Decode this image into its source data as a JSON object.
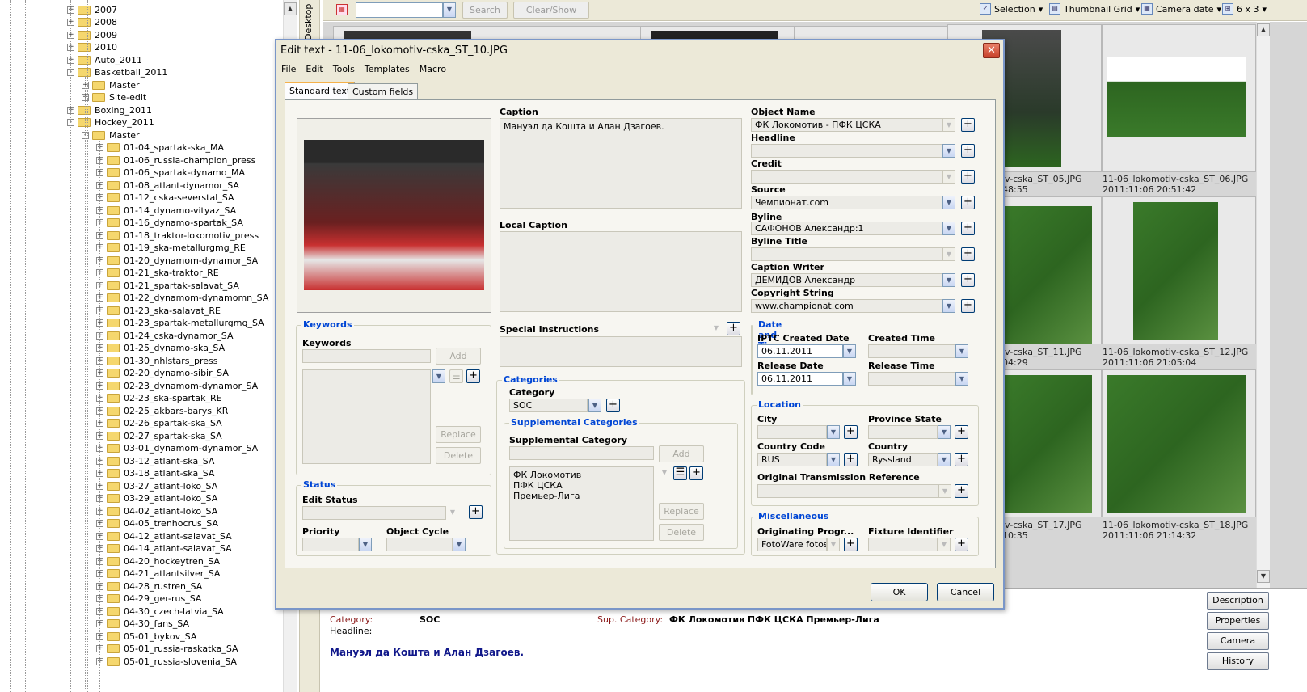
{
  "tree": {
    "items": [
      {
        "label": "2007",
        "level": 0,
        "sign": "+"
      },
      {
        "label": "2008",
        "level": 0,
        "sign": "+"
      },
      {
        "label": "2009",
        "level": 0,
        "sign": "+"
      },
      {
        "label": "2010",
        "level": 0,
        "sign": "+"
      },
      {
        "label": "Auto_2011",
        "level": 0,
        "sign": "+"
      },
      {
        "label": "Basketball_2011",
        "level": 0,
        "sign": "-"
      },
      {
        "label": "Master",
        "level": 1,
        "sign": "+"
      },
      {
        "label": "Site-edit",
        "level": 1,
        "sign": "+"
      },
      {
        "label": "Boxing_2011",
        "level": 0,
        "sign": "+"
      },
      {
        "label": "Hockey_2011",
        "level": 0,
        "sign": "-"
      },
      {
        "label": "Master",
        "level": 1,
        "sign": "-"
      },
      {
        "label": "01-04_spartak-ska_MA",
        "level": 2,
        "sign": "+"
      },
      {
        "label": "01-06_russia-champion_press",
        "level": 2,
        "sign": "+"
      },
      {
        "label": "01-06_spartak-dynamo_MA",
        "level": 2,
        "sign": "+"
      },
      {
        "label": "01-08_atlant-dynamor_SA",
        "level": 2,
        "sign": "+"
      },
      {
        "label": "01-12_cska-severstal_SA",
        "level": 2,
        "sign": "+"
      },
      {
        "label": "01-14_dynamo-vityaz_SA",
        "level": 2,
        "sign": "+"
      },
      {
        "label": "01-16_dynamo-spartak_SA",
        "level": 2,
        "sign": "+"
      },
      {
        "label": "01-18_traktor-lokomotiv_press",
        "level": 2,
        "sign": "+"
      },
      {
        "label": "01-19_ska-metallurgmg_RE",
        "level": 2,
        "sign": "+"
      },
      {
        "label": "01-20_dynamom-dynamor_SA",
        "level": 2,
        "sign": "+"
      },
      {
        "label": "01-21_ska-traktor_RE",
        "level": 2,
        "sign": "+"
      },
      {
        "label": "01-21_spartak-salavat_SA",
        "level": 2,
        "sign": "+"
      },
      {
        "label": "01-22_dynamom-dynamomn_SA",
        "level": 2,
        "sign": "+"
      },
      {
        "label": "01-23_ska-salavat_RE",
        "level": 2,
        "sign": "+"
      },
      {
        "label": "01-23_spartak-metallurgmg_SA",
        "level": 2,
        "sign": "+"
      },
      {
        "label": "01-24_cska-dynamor_SA",
        "level": 2,
        "sign": "+"
      },
      {
        "label": "01-25_dynamo-ska_SA",
        "level": 2,
        "sign": "+"
      },
      {
        "label": "01-30_nhlstars_press",
        "level": 2,
        "sign": "+"
      },
      {
        "label": "02-20_dynamo-sibir_SA",
        "level": 2,
        "sign": "+"
      },
      {
        "label": "02-23_dynamom-dynamor_SA",
        "level": 2,
        "sign": "+"
      },
      {
        "label": "02-23_ska-spartak_RE",
        "level": 2,
        "sign": "+"
      },
      {
        "label": "02-25_akbars-barys_KR",
        "level": 2,
        "sign": "+"
      },
      {
        "label": "02-26_spartak-ska_SA",
        "level": 2,
        "sign": "+"
      },
      {
        "label": "02-27_spartak-ska_SA",
        "level": 2,
        "sign": "+"
      },
      {
        "label": "03-01_dynamom-dynamor_SA",
        "level": 2,
        "sign": "+"
      },
      {
        "label": "03-12_atlant-ska_SA",
        "level": 2,
        "sign": "+"
      },
      {
        "label": "03-18_atlant-ska_SA",
        "level": 2,
        "sign": "+"
      },
      {
        "label": "03-27_atlant-loko_SA",
        "level": 2,
        "sign": "+"
      },
      {
        "label": "03-29_atlant-loko_SA",
        "level": 2,
        "sign": "+"
      },
      {
        "label": "04-02_atlant-loko_SA",
        "level": 2,
        "sign": "+"
      },
      {
        "label": "04-05_trenhocrus_SA",
        "level": 2,
        "sign": "+"
      },
      {
        "label": "04-12_atlant-salavat_SA",
        "level": 2,
        "sign": "+"
      },
      {
        "label": "04-14_atlant-salavat_SA",
        "level": 2,
        "sign": "+"
      },
      {
        "label": "04-20_hockeytren_SA",
        "level": 2,
        "sign": "+"
      },
      {
        "label": "04-21_atlantsilver_SA",
        "level": 2,
        "sign": "+"
      },
      {
        "label": "04-28_rustren_SA",
        "level": 2,
        "sign": "+"
      },
      {
        "label": "04-29_ger-rus_SA",
        "level": 2,
        "sign": "+"
      },
      {
        "label": "04-30_czech-latvia_SA",
        "level": 2,
        "sign": "+"
      },
      {
        "label": "04-30_fans_SA",
        "level": 2,
        "sign": "+"
      },
      {
        "label": "05-01_bykov_SA",
        "level": 2,
        "sign": "+"
      },
      {
        "label": "05-01_russia-raskatka_SA",
        "level": 2,
        "sign": "+"
      },
      {
        "label": "05-01_russia-slovenia_SA",
        "level": 2,
        "sign": "+"
      }
    ],
    "side_tab": "Desktop"
  },
  "toolbar": {
    "search_label": "Search",
    "clear_label": "Clear/Show All",
    "selection_label": "Selection",
    "view_label": "Thumbnail Grid",
    "sort_label": "Camera date",
    "grid_label": "6 x 3"
  },
  "thumbs": [
    {
      "cap1": "iv-cska_ST_05.JPG",
      "cap2": "48:55"
    },
    {
      "cap1": "11-06_lokomotiv-cska_ST_06.JPG",
      "cap2": "2011:11:06 20:51:42"
    },
    {
      "cap1": "iv-cska_ST_11.JPG",
      "cap2": "04:29"
    },
    {
      "cap1": "11-06_lokomotiv-cska_ST_12.JPG",
      "cap2": "2011:11:06 21:05:04"
    },
    {
      "cap1": "iv-cska_ST_17.JPG",
      "cap2": "10:35"
    },
    {
      "cap1": "11-06_lokomotiv-cska_ST_18.JPG",
      "cap2": "2011:11:06 21:14:32"
    }
  ],
  "bottom": {
    "category_label": "Category:",
    "category_value": "SOC",
    "supcat_label": "Sup. Category:",
    "supcat_value": "ФК Локомотив ПФК ЦСКА Премьер-Лига",
    "headline_label": "Headline:",
    "caption": "Мануэл да Кошта и Алан Дзагоев.",
    "buttons": [
      "Description",
      "Properties",
      "Camera",
      "History"
    ]
  },
  "dialog": {
    "title": "Edit text - 11-06_lokomotiv-cska_ST_10.JPG",
    "menu": [
      "File",
      "Edit",
      "Tools",
      "Templates",
      "Macro"
    ],
    "tabs": [
      "Standard text",
      "Custom fields"
    ],
    "caption_label": "Caption",
    "caption_value": "Мануэл да Кошта и Алан Дзагоев.",
    "local_caption_label": "Local Caption",
    "special_instructions_label": "Special Instructions",
    "keywords_group": "Keywords",
    "keywords_label": "Keywords",
    "add_label": "Add",
    "replace_label": "Replace",
    "delete_label": "Delete",
    "status_group": "Status",
    "edit_status_label": "Edit Status",
    "priority_label": "Priority",
    "object_cycle_label": "Object Cycle",
    "categories_group": "Categories",
    "category_label": "Category",
    "category_value": "SOC",
    "supp_group": "Supplemental Categories",
    "supp_label": "Supplemental Category",
    "supp_values": [
      "ФК Локомотив",
      "ПФК ЦСКА",
      "Премьер-Лига"
    ],
    "object_name_label": "Object Name",
    "object_name_value": "ФК Локомотив - ПФК ЦСКА",
    "headline_label": "Headline",
    "credit_label": "Credit",
    "source_label": "Source",
    "source_value": "Чемпионат.com",
    "byline_label": "Byline",
    "byline_value": "САФОНОВ Александр:1",
    "byline_title_label": "Byline Title",
    "caption_writer_label": "Caption Writer",
    "caption_writer_value": "ДЕМИДОВ Александр",
    "copyright_label": "Copyright String",
    "copyright_value": "www.championat.com",
    "datetime_group": "Date and Time",
    "iptc_created_label": "IPTC Created Date",
    "iptc_created_value": "06.11.2011",
    "created_time_label": "Created Time",
    "release_date_label": "Release Date",
    "release_date_value": "06.11.2011",
    "release_time_label": "Release Time",
    "location_group": "Location",
    "city_label": "City",
    "province_label": "Province State",
    "country_code_label": "Country Code",
    "country_code_value": "RUS",
    "country_label": "Country",
    "country_value": "Ryssland",
    "otr_label": "Original Transmission Reference",
    "misc_group": "Miscellaneous",
    "orig_prog_label": "Originating Progr...",
    "orig_prog_value": "FotoWare fotos",
    "fixture_label": "Fixture Identifier",
    "ok_label": "OK",
    "cancel_label": "Cancel"
  }
}
